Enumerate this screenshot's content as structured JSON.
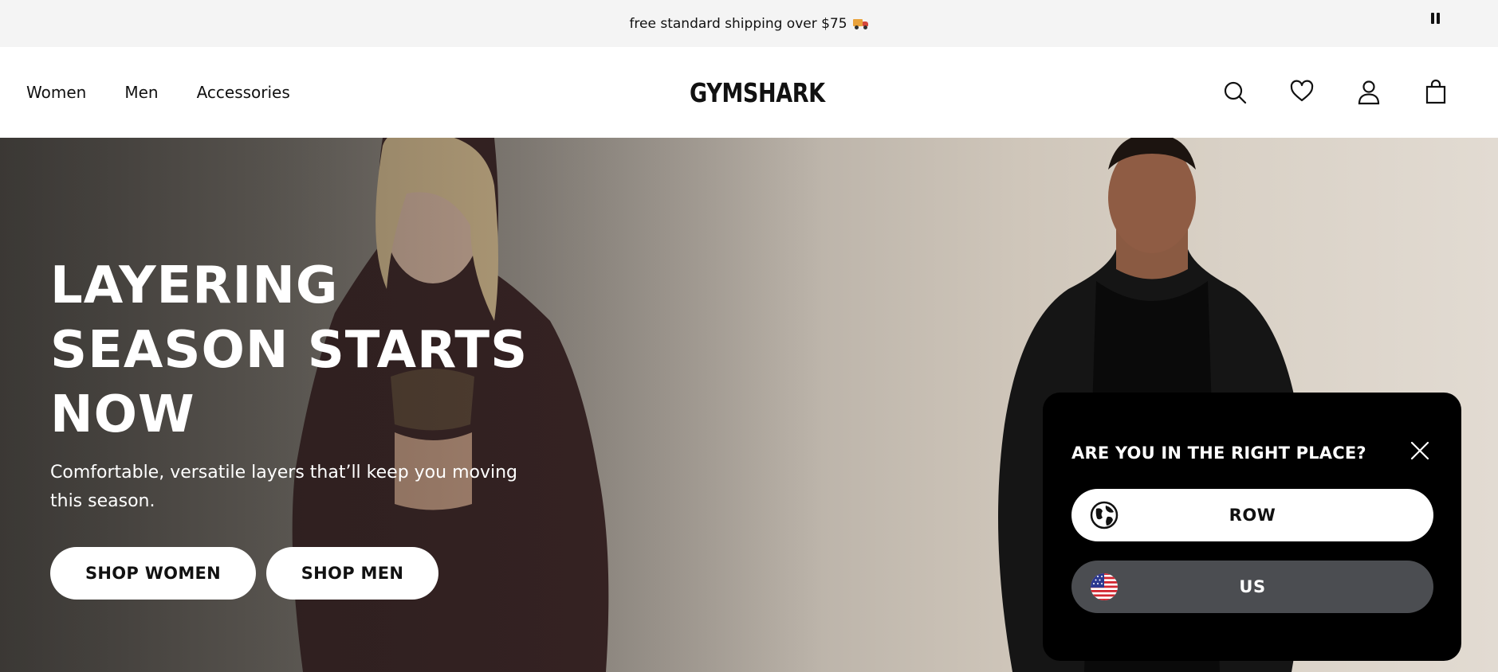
{
  "announcement": {
    "text": "free standard shipping over $75",
    "truck_icon": "truck-emoji-icon",
    "pause_icon": "pause-icon"
  },
  "header": {
    "nav": [
      "Women",
      "Men",
      "Accessories"
    ],
    "logo": "GYMSHARK",
    "icons": [
      "search-icon",
      "heart-icon",
      "user-icon",
      "bag-icon"
    ]
  },
  "hero": {
    "headline_lines": [
      "LAYERING",
      "SEASON STARTS",
      "NOW"
    ],
    "subtitle": "Comfortable, versatile layers that’ll keep you moving this season.",
    "cta_women": "SHOP WOMEN",
    "cta_men": "SHOP MEN"
  },
  "region_popup": {
    "title": "ARE YOU IN THE RIGHT PLACE?",
    "options": [
      {
        "label": "ROW",
        "icon": "globe-icon"
      },
      {
        "label": "US",
        "icon": "us-flag-icon"
      }
    ],
    "close_icon": "close-icon"
  },
  "colors": {
    "popup_bg": "#000000",
    "us_button_bg": "#4b4d51",
    "announcement_bg": "#f4f4f4"
  }
}
